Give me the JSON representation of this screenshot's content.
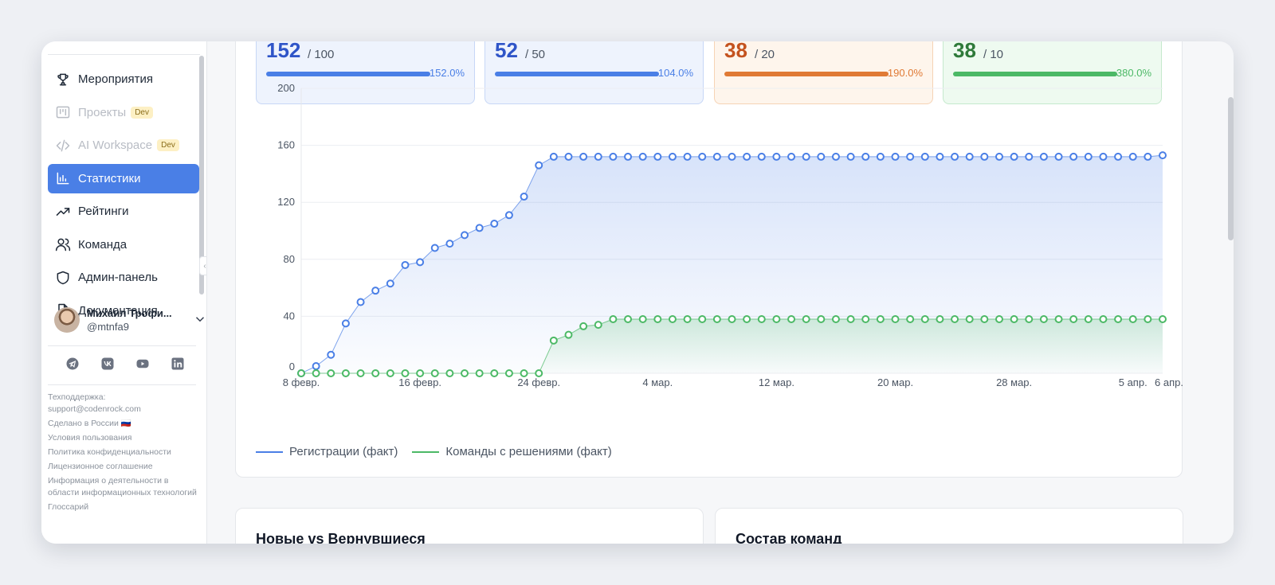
{
  "sidebar": {
    "items": [
      {
        "label": "Мероприятия",
        "icon": "trophy-icon",
        "state": "normal"
      },
      {
        "label": "Проекты",
        "icon": "kanban-icon",
        "state": "disabled",
        "badge": "Dev"
      },
      {
        "label": "AI Workspace",
        "icon": "code-icon",
        "state": "disabled",
        "badge": "Dev"
      },
      {
        "label": "Статистики",
        "icon": "bar-chart-icon",
        "state": "active"
      },
      {
        "label": "Рейтинги",
        "icon": "trending-up-icon",
        "state": "normal"
      },
      {
        "label": "Команда",
        "icon": "users-icon",
        "state": "normal"
      },
      {
        "label": "Админ-панель",
        "icon": "shield-icon",
        "state": "normal"
      },
      {
        "label": "Документация",
        "icon": "document-icon",
        "state": "normal"
      }
    ],
    "user": {
      "name": "Михаил Трофи...",
      "handle": "@mtnfa9"
    },
    "socials": [
      "telegram-icon",
      "vk-icon",
      "youtube-icon",
      "linkedin-icon"
    ],
    "footer": {
      "support_label": "Техподдержка:",
      "support_email": "support@codenrock.com",
      "made_in": "Сделано в России 🇷🇺",
      "terms": "Условия пользования",
      "privacy": "Политика конфиденциальности",
      "license": "Лицензионное соглашение",
      "it_info": "Информация о деятельности в области информационных технологий",
      "glossary": "Глоссарий"
    }
  },
  "kpis": [
    {
      "value": "152",
      "target": "/ 100",
      "percent": "152.0%",
      "fill": 1.0,
      "accent": "#2f55c8",
      "bar": "#4a7fe6",
      "bg": "#eef3fd",
      "border": "#c7d7f6"
    },
    {
      "value": "52",
      "target": "/ 50",
      "percent": "104.0%",
      "fill": 1.0,
      "accent": "#2f55c8",
      "bar": "#4a7fe6",
      "bg": "#eef3fd",
      "border": "#c7d7f6"
    },
    {
      "value": "38",
      "target": "/ 20",
      "percent": "190.0%",
      "fill": 1.0,
      "accent": "#c4531f",
      "bar": "#e07a35",
      "bg": "#fef5ec",
      "border": "#f6d3b5"
    },
    {
      "value": "38",
      "target": "/ 10",
      "percent": "380.0%",
      "fill": 1.0,
      "accent": "#2f7a3a",
      "bar": "#4cb966",
      "bg": "#eefaf0",
      "border": "#c5e9cd"
    }
  ],
  "chart_data": {
    "type": "line",
    "ylim": [
      0,
      200
    ],
    "yticks": [
      0,
      40,
      80,
      120,
      160,
      200
    ],
    "xticks": [
      "8 февр.",
      "16 февр.",
      "24 февр.",
      "4 мар.",
      "12 мар.",
      "20 мар.",
      "28 мар.",
      "5 апр.",
      "6 апр."
    ],
    "series": [
      {
        "name": "Регистрации (факт)",
        "color": "#4a7fe6",
        "values": [
          0,
          5,
          13,
          35,
          50,
          58,
          63,
          76,
          78,
          88,
          91,
          97,
          102,
          105,
          111,
          124,
          146,
          152,
          152,
          152,
          152,
          152,
          152,
          152,
          152,
          152,
          152,
          152,
          152,
          152,
          152,
          152,
          152,
          152,
          152,
          152,
          152,
          152,
          152,
          152,
          152,
          152,
          152,
          152,
          152,
          152,
          152,
          152,
          152,
          152,
          152,
          152,
          152,
          152,
          152,
          152,
          152,
          152,
          153
        ]
      },
      {
        "name": "Команды с решениями (факт)",
        "color": "#4cb966",
        "values": [
          0,
          0,
          0,
          0,
          0,
          0,
          0,
          0,
          0,
          0,
          0,
          0,
          0,
          0,
          0,
          0,
          0,
          23,
          27,
          33,
          34,
          38,
          38,
          38,
          38,
          38,
          38,
          38,
          38,
          38,
          38,
          38,
          38,
          38,
          38,
          38,
          38,
          38,
          38,
          38,
          38,
          38,
          38,
          38,
          38,
          38,
          38,
          38,
          38,
          38,
          38,
          38,
          38,
          38,
          38,
          38,
          38,
          38,
          38
        ]
      }
    ]
  },
  "cards": [
    {
      "title": "Новые vs Вернувшиеся"
    },
    {
      "title": "Состав команд"
    }
  ]
}
